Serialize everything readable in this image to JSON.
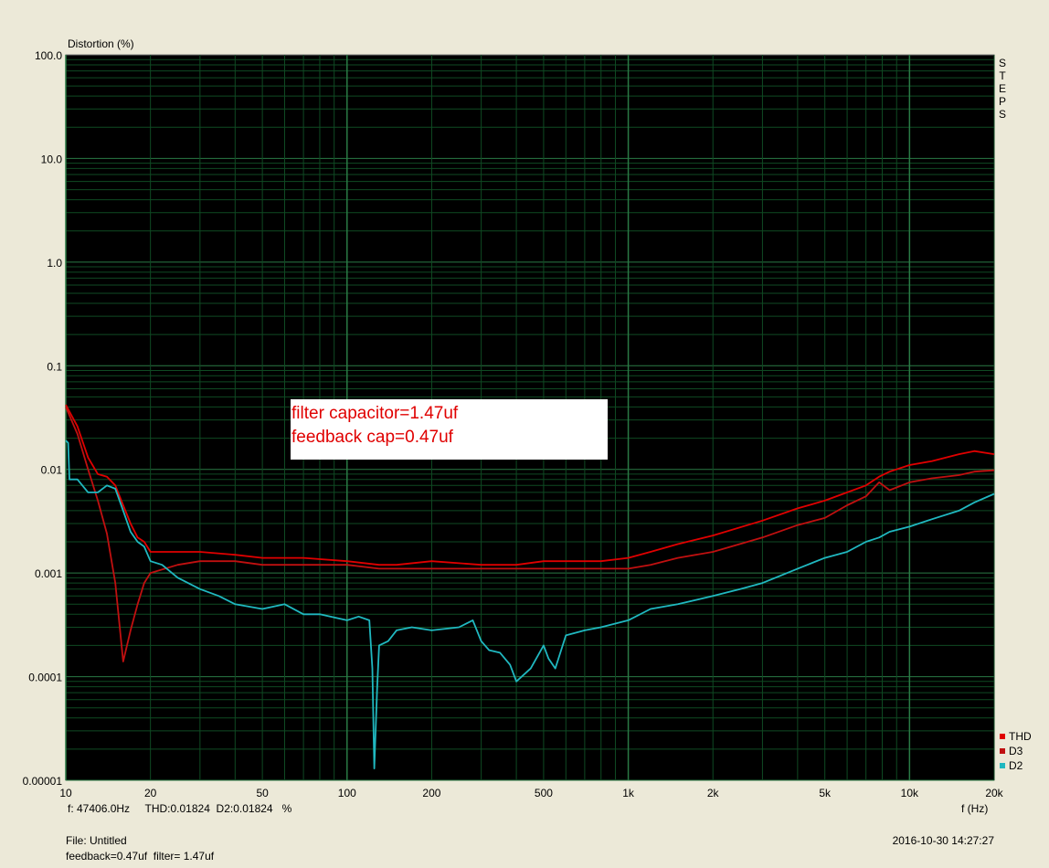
{
  "chart_data": {
    "type": "line",
    "ylabel": "Distortion (%)",
    "xlabel": "f (Hz)",
    "x_scale": "log",
    "y_scale": "log",
    "xlim": [
      10,
      20000
    ],
    "ylim": [
      1e-05,
      100
    ],
    "grid": true,
    "x_ticks": [
      {
        "v": 10,
        "label": "10"
      },
      {
        "v": 20,
        "label": "20"
      },
      {
        "v": 50,
        "label": "50"
      },
      {
        "v": 100,
        "label": "100"
      },
      {
        "v": 200,
        "label": "200"
      },
      {
        "v": 500,
        "label": "500"
      },
      {
        "v": 1000,
        "label": "1k"
      },
      {
        "v": 2000,
        "label": "2k"
      },
      {
        "v": 5000,
        "label": "5k"
      },
      {
        "v": 10000,
        "label": "10k"
      },
      {
        "v": 20000,
        "label": "20k"
      }
    ],
    "y_ticks": [
      {
        "v": 100,
        "label": "100.0"
      },
      {
        "v": 10,
        "label": "10.0"
      },
      {
        "v": 1,
        "label": "1.0"
      },
      {
        "v": 0.1,
        "label": "0.1"
      },
      {
        "v": 0.01,
        "label": "0.01"
      },
      {
        "v": 0.001,
        "label": "0.001"
      },
      {
        "v": 0.0001,
        "label": "0.0001"
      },
      {
        "v": 1e-05,
        "label": "0.00001"
      }
    ],
    "side_label": "STEPS",
    "annotation": [
      "filter capacitor=1.47uf",
      "feedback  cap=0.47uf"
    ],
    "legend_position": "bottom-right",
    "series": [
      {
        "name": "THD",
        "color": "#e00000",
        "x": [
          10,
          11,
          12,
          13,
          14,
          15,
          16,
          17,
          18,
          19,
          20,
          25,
          30,
          40,
          50,
          70,
          100,
          130,
          150,
          200,
          300,
          400,
          500,
          600,
          800,
          1000,
          1200,
          1500,
          2000,
          3000,
          4000,
          5000,
          6000,
          7000,
          7800,
          8500,
          10000,
          12000,
          15000,
          17000,
          20000
        ],
        "y": [
          0.042,
          0.026,
          0.013,
          0.009,
          0.0085,
          0.007,
          0.0045,
          0.003,
          0.0022,
          0.002,
          0.0016,
          0.0016,
          0.0016,
          0.0015,
          0.0014,
          0.0014,
          0.0013,
          0.0012,
          0.0012,
          0.0013,
          0.0012,
          0.0012,
          0.0013,
          0.0013,
          0.0013,
          0.0014,
          0.0016,
          0.0019,
          0.0023,
          0.0032,
          0.0042,
          0.005,
          0.006,
          0.007,
          0.0085,
          0.0095,
          0.011,
          0.012,
          0.014,
          0.015,
          0.014
        ]
      },
      {
        "name": "D3",
        "color": "#c01010",
        "x": [
          10,
          11,
          12,
          13,
          14,
          15,
          16,
          17,
          18,
          19,
          20,
          25,
          30,
          40,
          50,
          70,
          100,
          130,
          150,
          200,
          300,
          400,
          500,
          600,
          800,
          1000,
          1200,
          1500,
          2000,
          3000,
          4000,
          5000,
          6000,
          7000,
          7800,
          8500,
          10000,
          12000,
          15000,
          17000,
          20000
        ],
        "y": [
          0.04,
          0.022,
          0.01,
          0.005,
          0.0024,
          0.0008,
          0.00014,
          0.00028,
          0.0005,
          0.0008,
          0.001,
          0.0012,
          0.0013,
          0.0013,
          0.0012,
          0.0012,
          0.0012,
          0.0011,
          0.0011,
          0.0011,
          0.0011,
          0.0011,
          0.0011,
          0.0011,
          0.0011,
          0.0011,
          0.0012,
          0.0014,
          0.0016,
          0.0022,
          0.0029,
          0.0034,
          0.0045,
          0.0055,
          0.0075,
          0.0063,
          0.0075,
          0.0082,
          0.0088,
          0.0095,
          0.0098
        ]
      },
      {
        "name": "D2",
        "color": "#20b8c0",
        "x": [
          10,
          10.2,
          10.3,
          11,
          12,
          13,
          14,
          15,
          16,
          17,
          18,
          19,
          20,
          22,
          25,
          30,
          35,
          40,
          50,
          60,
          70,
          80,
          100,
          110,
          120,
          123,
          125,
          128,
          130,
          140,
          150,
          170,
          200,
          250,
          280,
          300,
          320,
          350,
          380,
          400,
          450,
          500,
          520,
          550,
          600,
          700,
          800,
          1000,
          1200,
          1500,
          2000,
          2500,
          3000,
          4000,
          5000,
          6000,
          7000,
          7800,
          8500,
          10000,
          12000,
          15000,
          17000,
          20000
        ],
        "y": [
          0.019,
          0.018,
          0.008,
          0.008,
          0.006,
          0.006,
          0.007,
          0.0065,
          0.004,
          0.0025,
          0.002,
          0.0018,
          0.0013,
          0.0012,
          0.0009,
          0.0007,
          0.0006,
          0.0005,
          0.00045,
          0.0005,
          0.0004,
          0.0004,
          0.00035,
          0.00038,
          0.00035,
          0.00012,
          1.3e-05,
          8e-05,
          0.0002,
          0.00022,
          0.00028,
          0.0003,
          0.00028,
          0.0003,
          0.00035,
          0.00022,
          0.00018,
          0.00017,
          0.00013,
          9e-05,
          0.00012,
          0.0002,
          0.00015,
          0.00012,
          0.00025,
          0.00028,
          0.0003,
          0.00035,
          0.00045,
          0.0005,
          0.0006,
          0.0007,
          0.0008,
          0.0011,
          0.0014,
          0.0016,
          0.002,
          0.0022,
          0.0025,
          0.0028,
          0.0033,
          0.004,
          0.0048,
          0.0058
        ]
      }
    ]
  },
  "footer": {
    "cursor_readout": "f: 47406.0Hz     THD:0.01824  D2:0.01824   %",
    "file_label": "File: Untitled",
    "notes": "feedback=0.47uf  filter= 1.47uf",
    "timestamp": "2016-10-30 14:27:27"
  },
  "colors": {
    "plot_bg": "#000000",
    "grid_major": "#2a7a45",
    "grid_minor": "#0f4a23",
    "window_bg": "#ece9d8"
  }
}
